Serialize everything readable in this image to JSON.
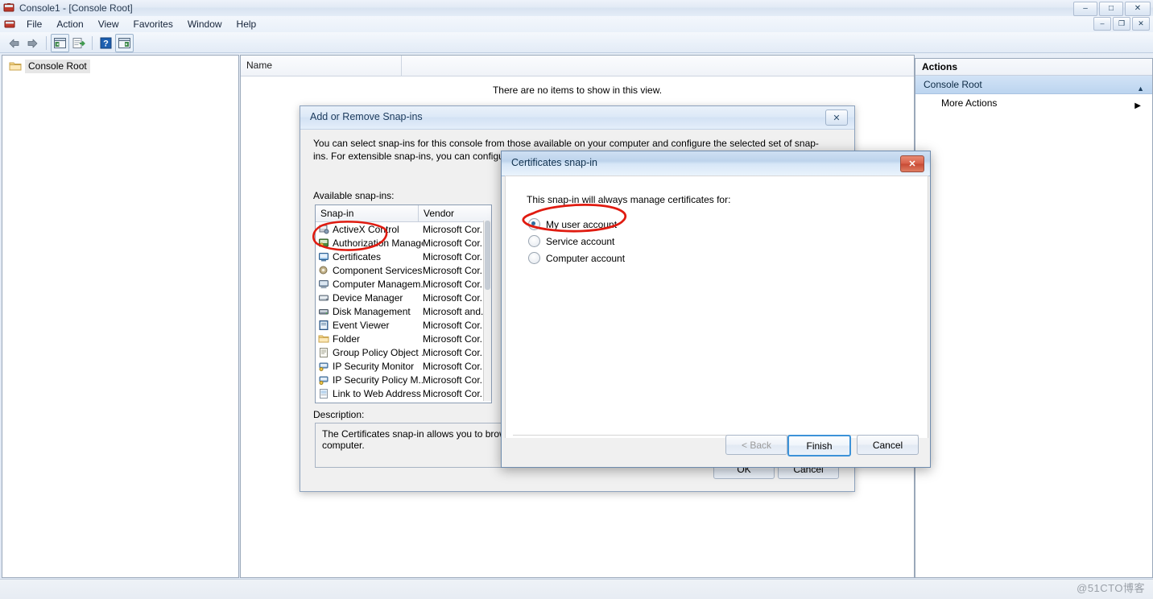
{
  "window": {
    "title": "Console1 - [Console Root]",
    "icon": "mmc-console-icon",
    "buttons": {
      "minimize": "–",
      "maximize": "□",
      "close": "✕"
    },
    "mdi_buttons": {
      "minimize": "–",
      "restore": "❐",
      "close": "✕"
    }
  },
  "menubar": {
    "items": [
      {
        "label": "File"
      },
      {
        "label": "Action"
      },
      {
        "label": "View"
      },
      {
        "label": "Favorites"
      },
      {
        "label": "Window"
      },
      {
        "label": "Help"
      }
    ]
  },
  "toolbar": {
    "back": "back-arrow-icon",
    "forward": "forward-arrow-icon",
    "show_hide_tree": "show-hide-console-tree-icon",
    "export_list": "export-list-icon",
    "help": "help-icon",
    "show_hide_action_pane": "show-hide-action-pane-icon"
  },
  "tree": {
    "root_label": "Console Root"
  },
  "list_view": {
    "columns": [
      "Name",
      ""
    ],
    "empty_message": "There are no items to show in this view."
  },
  "actions_pane": {
    "title": "Actions",
    "group": "Console Root",
    "collapse_glyph": "▲",
    "items": [
      {
        "label": "More Actions",
        "chevron": "▶"
      }
    ]
  },
  "statusbar": {
    "watermark": "@51CTO博客"
  },
  "dialog_add_remove": {
    "title": "Add or Remove Snap-ins",
    "close_glyph": "✕",
    "intro": "You can select snap-ins for this console from those available on your computer and configure the selected set of snap-ins. For extensible snap-ins, you can configure which extensions are enabled.",
    "available_label": "Available snap-ins:",
    "columns": [
      "Snap-in",
      "Vendor"
    ],
    "rows": [
      {
        "name": "ActiveX Control",
        "vendor": "Microsoft Cor...",
        "icon": "activex-icon"
      },
      {
        "name": "Authorization Manager",
        "vendor": "Microsoft Cor...",
        "icon": "authorization-manager-icon"
      },
      {
        "name": "Certificates",
        "vendor": "Microsoft Cor...",
        "icon": "certificates-icon"
      },
      {
        "name": "Component Services",
        "vendor": "Microsoft Cor...",
        "icon": "component-services-icon"
      },
      {
        "name": "Computer Managem...",
        "vendor": "Microsoft Cor...",
        "icon": "computer-management-icon"
      },
      {
        "name": "Device Manager",
        "vendor": "Microsoft Cor...",
        "icon": "device-manager-icon"
      },
      {
        "name": "Disk Management",
        "vendor": "Microsoft and...",
        "icon": "disk-management-icon"
      },
      {
        "name": "Event Viewer",
        "vendor": "Microsoft Cor...",
        "icon": "event-viewer-icon"
      },
      {
        "name": "Folder",
        "vendor": "Microsoft Cor...",
        "icon": "folder-icon"
      },
      {
        "name": "Group Policy Object ...",
        "vendor": "Microsoft Cor...",
        "icon": "group-policy-icon"
      },
      {
        "name": "IP Security Monitor",
        "vendor": "Microsoft Cor...",
        "icon": "ip-security-monitor-icon"
      },
      {
        "name": "IP Security Policy M...",
        "vendor": "Microsoft Cor...",
        "icon": "ip-security-policy-icon"
      },
      {
        "name": "Link to Web Address",
        "vendor": "Microsoft Cor...",
        "icon": "link-to-web-address-icon"
      }
    ],
    "description_label": "Description:",
    "description_text": "The Certificates snap-in allows you to browse the contents of the certificate stores for yourself, a service, or a computer.",
    "ok_label": "OK",
    "cancel_label": "Cancel"
  },
  "dialog_certificates": {
    "title": "Certificates snap-in",
    "close_glyph": "✕",
    "prompt": "This snap-in will always manage certificates for:",
    "options": [
      {
        "label": "My user account",
        "selected": true
      },
      {
        "label": "Service account",
        "selected": false
      },
      {
        "label": "Computer account",
        "selected": false
      }
    ],
    "back_label": "< Back",
    "finish_label": "Finish",
    "cancel_label": "Cancel"
  },
  "annotations": {
    "color": "#e01b10",
    "circle_snapin": "red-ellipse-around-certificates",
    "circle_radio": "red-ellipse-around-my-user-account"
  }
}
